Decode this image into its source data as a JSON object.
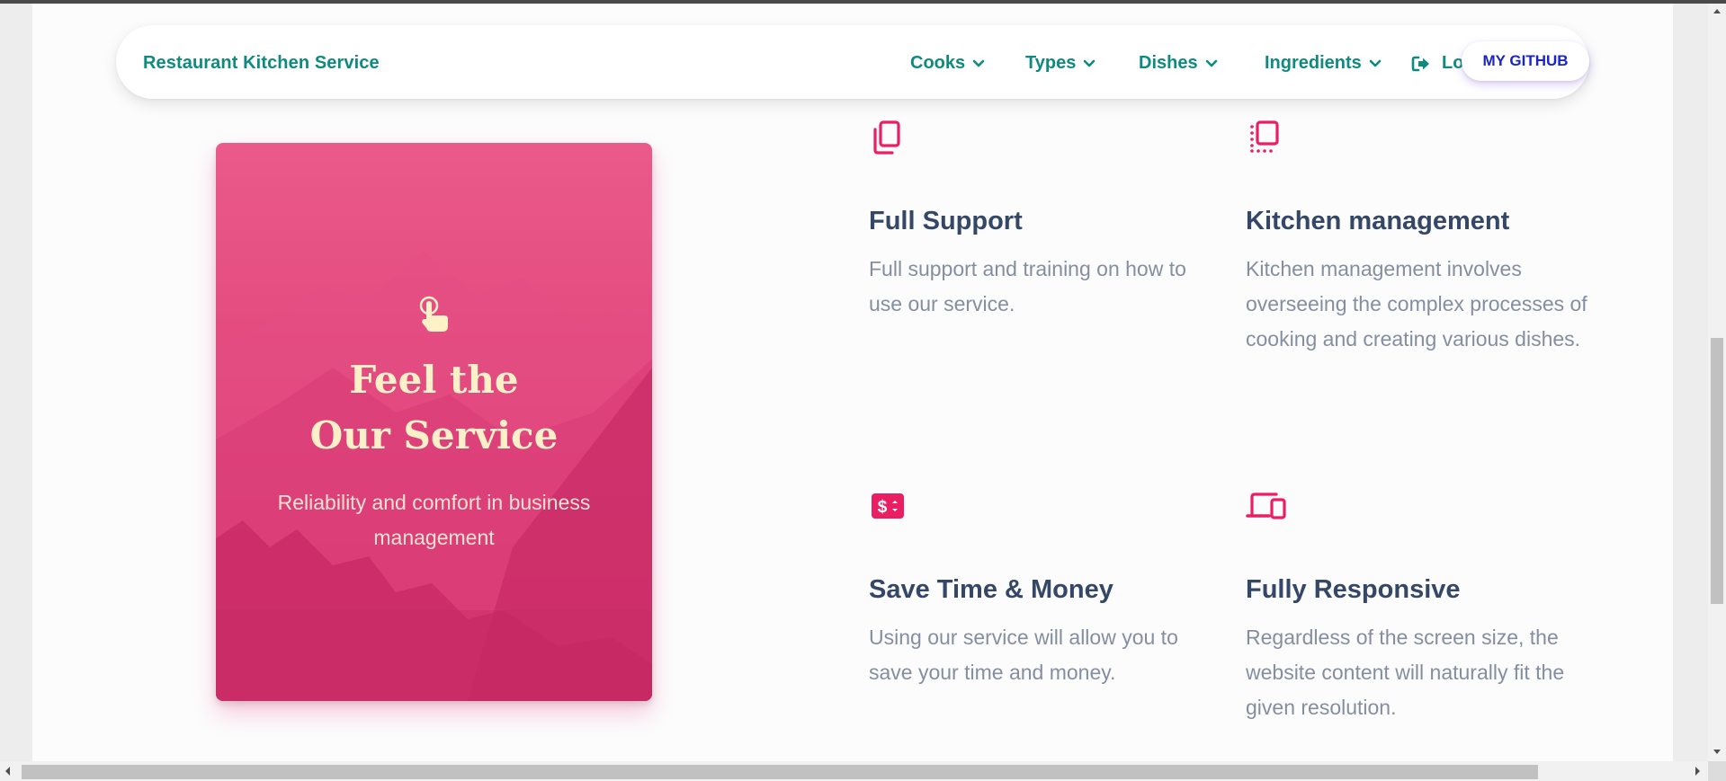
{
  "brand": "Restaurant Kitchen Service",
  "nav": {
    "cooks": "Cooks",
    "types": "Types",
    "dishes": "Dishes",
    "ingredients": "Ingredients",
    "logout": "Logout",
    "github": "MY GITHUB"
  },
  "card": {
    "title_line1": "Feel the",
    "title_line2": "Our Service",
    "subtitle": "Reliability and comfort in business management"
  },
  "features": [
    {
      "icon": "copy-icon",
      "title": "Full Support",
      "text": "Full support and training on how to use our service."
    },
    {
      "icon": "library-icon",
      "title": "Kitchen management",
      "text": "Kitchen management involves overseeing the complex processes of cooking and creating various dishes."
    },
    {
      "icon": "money-icon",
      "title": "Save Time & Money",
      "text": "Using our service will allow you to save your time and money."
    },
    {
      "icon": "devices-icon",
      "title": "Fully Responsive",
      "text": "Regardless of the screen size, the website content will naturally fit the given resolution."
    }
  ],
  "colors": {
    "accent": "#e91e63",
    "brand_teal": "#0e8a80",
    "heading": "#344767",
    "body_text": "#858ea0",
    "card_title": "#fbf0c8"
  }
}
